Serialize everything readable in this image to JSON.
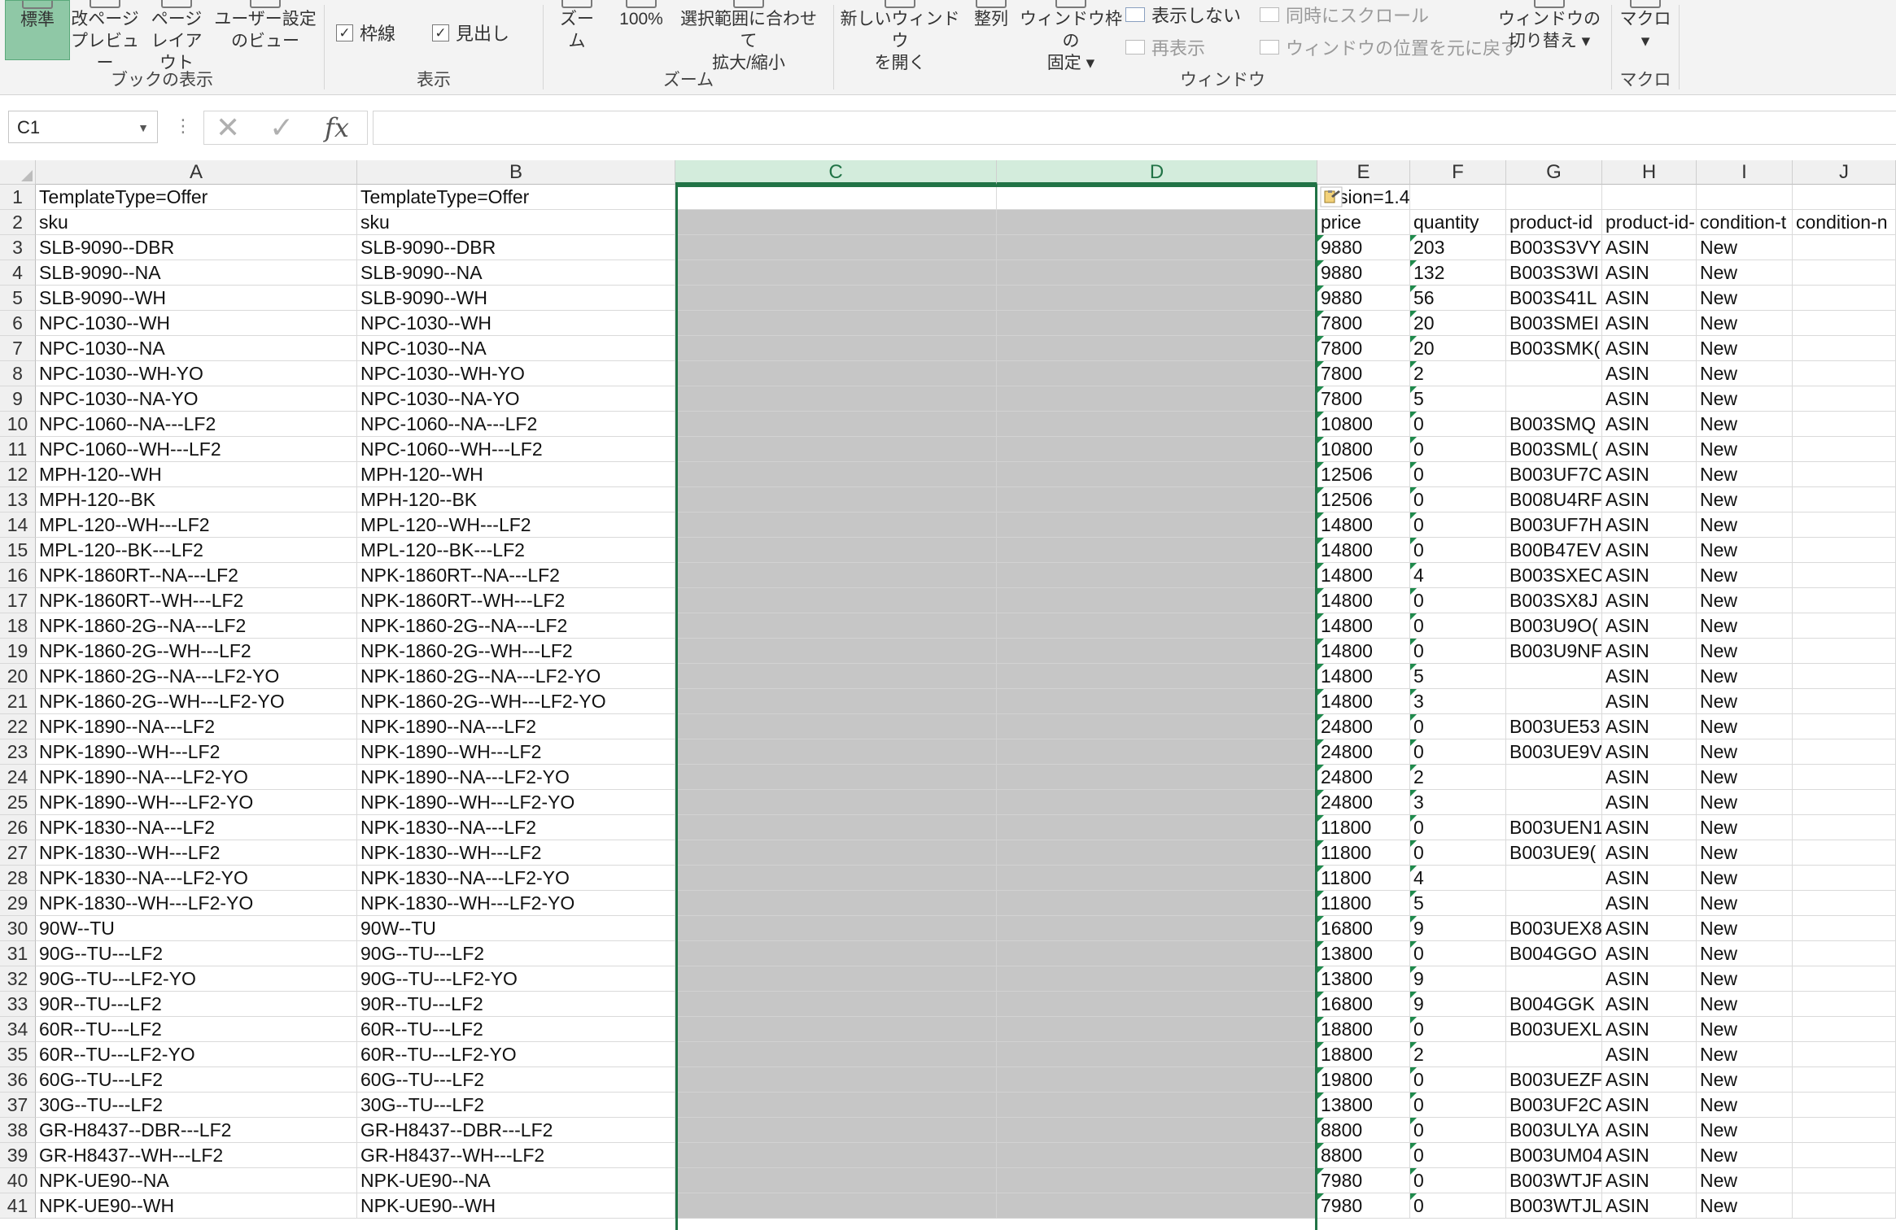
{
  "ribbon": {
    "groups": {
      "book_view": {
        "label": "ブックの表示",
        "buttons": [
          {
            "name": "normal",
            "label": "標準",
            "active": true
          },
          {
            "name": "page-break-preview",
            "label": "改ページ\nプレビュー"
          },
          {
            "name": "page-layout",
            "label": "ページ\nレイアウト"
          },
          {
            "name": "custom-views",
            "label": "ユーザー設定\nのビュー"
          }
        ]
      },
      "show": {
        "label": "表示",
        "gridlines": "枠線",
        "headings": "見出し"
      },
      "zoom": {
        "label": "ズーム",
        "buttons": [
          {
            "name": "zoom",
            "label": "ズーム"
          },
          {
            "name": "zoom-100",
            "label": "100%"
          },
          {
            "name": "zoom-to-selection",
            "label": "選択範囲に合わせて\n拡大/縮小"
          }
        ]
      },
      "window": {
        "label": "ウィンドウ",
        "new_window": "新しいウィンドウ\nを開く",
        "arrange": "整列",
        "freeze": "ウィンドウ枠の\n固定 ▾",
        "hide": "表示しない",
        "unhide": "再表示",
        "sync_scroll": "同時にスクロール",
        "reset_position": "ウィンドウの位置を元に戻す",
        "switch": "ウィンドウの\n切り替え ▾"
      },
      "macro": {
        "label": "マクロ",
        "macros": "マクロ\n▾"
      }
    }
  },
  "formula_bar": {
    "name_box": "C1",
    "formula": "",
    "fx_label": "fx"
  },
  "grid": {
    "columns": [
      "A",
      "B",
      "C",
      "D",
      "E",
      "F",
      "G",
      "H",
      "I",
      "J"
    ],
    "selected_columns": [
      "C",
      "D"
    ],
    "row1": {
      "A": "TemplateType=Offer",
      "B": "TemplateType=Offer",
      "E": "sion=1.4"
    },
    "row2": {
      "A": "sku",
      "B": "sku",
      "E": "price",
      "F": "quantity",
      "G": "product-id",
      "H": "product-id-",
      "I": "condition-t",
      "J": "condition-n"
    },
    "data_rows": [
      [
        "3",
        "SLB-9090--DBR",
        "SLB-9090--DBR",
        "9880",
        "203",
        "B003S3VY",
        "ASIN",
        "New"
      ],
      [
        "4",
        "SLB-9090--NA",
        "SLB-9090--NA",
        "9880",
        "132",
        "B003S3WI",
        "ASIN",
        "New"
      ],
      [
        "5",
        "SLB-9090--WH",
        "SLB-9090--WH",
        "9880",
        "56",
        "B003S41L",
        "ASIN",
        "New"
      ],
      [
        "6",
        "NPC-1030--WH",
        "NPC-1030--WH",
        "7800",
        "20",
        "B003SMEI",
        "ASIN",
        "New"
      ],
      [
        "7",
        "NPC-1030--NA",
        "NPC-1030--NA",
        "7800",
        "20",
        "B003SMK(",
        "ASIN",
        "New"
      ],
      [
        "8",
        "NPC-1030--WH-YO",
        "NPC-1030--WH-YO",
        "7800",
        "2",
        "",
        "ASIN",
        "New"
      ],
      [
        "9",
        "NPC-1030--NA-YO",
        "NPC-1030--NA-YO",
        "7800",
        "5",
        "",
        "ASIN",
        "New"
      ],
      [
        "10",
        "NPC-1060--NA---LF2",
        "NPC-1060--NA---LF2",
        "10800",
        "0",
        "B003SMQ",
        "ASIN",
        "New"
      ],
      [
        "11",
        "NPC-1060--WH---LF2",
        "NPC-1060--WH---LF2",
        "10800",
        "0",
        "B003SML(",
        "ASIN",
        "New"
      ],
      [
        "12",
        "MPH-120--WH",
        "MPH-120--WH",
        "12506",
        "0",
        "B003UF7C",
        "ASIN",
        "New"
      ],
      [
        "13",
        "MPH-120--BK",
        "MPH-120--BK",
        "12506",
        "0",
        "B008U4RF",
        "ASIN",
        "New"
      ],
      [
        "14",
        "MPL-120--WH---LF2",
        "MPL-120--WH---LF2",
        "14800",
        "0",
        "B003UF7H",
        "ASIN",
        "New"
      ],
      [
        "15",
        "MPL-120--BK---LF2",
        "MPL-120--BK---LF2",
        "14800",
        "0",
        "B00B47EV",
        "ASIN",
        "New"
      ],
      [
        "16",
        "NPK-1860RT--NA---LF2",
        "NPK-1860RT--NA---LF2",
        "14800",
        "4",
        "B003SXEC",
        "ASIN",
        "New"
      ],
      [
        "17",
        "NPK-1860RT--WH---LF2",
        "NPK-1860RT--WH---LF2",
        "14800",
        "0",
        "B003SX8J",
        "ASIN",
        "New"
      ],
      [
        "18",
        "NPK-1860-2G--NA---LF2",
        "NPK-1860-2G--NA---LF2",
        "14800",
        "0",
        "B003U9O(",
        "ASIN",
        "New"
      ],
      [
        "19",
        "NPK-1860-2G--WH---LF2",
        "NPK-1860-2G--WH---LF2",
        "14800",
        "0",
        "B003U9NF",
        "ASIN",
        "New"
      ],
      [
        "20",
        "NPK-1860-2G--NA---LF2-YO",
        "NPK-1860-2G--NA---LF2-YO",
        "14800",
        "5",
        "",
        "ASIN",
        "New"
      ],
      [
        "21",
        "NPK-1860-2G--WH---LF2-YO",
        "NPK-1860-2G--WH---LF2-YO",
        "14800",
        "3",
        "",
        "ASIN",
        "New"
      ],
      [
        "22",
        "NPK-1890--NA---LF2",
        "NPK-1890--NA---LF2",
        "24800",
        "0",
        "B003UE53",
        "ASIN",
        "New"
      ],
      [
        "23",
        "NPK-1890--WH---LF2",
        "NPK-1890--WH---LF2",
        "24800",
        "0",
        "B003UE9V",
        "ASIN",
        "New"
      ],
      [
        "24",
        "NPK-1890--NA---LF2-YO",
        "NPK-1890--NA---LF2-YO",
        "24800",
        "2",
        "",
        "ASIN",
        "New"
      ],
      [
        "25",
        "NPK-1890--WH---LF2-YO",
        "NPK-1890--WH---LF2-YO",
        "24800",
        "3",
        "",
        "ASIN",
        "New"
      ],
      [
        "26",
        "NPK-1830--NA---LF2",
        "NPK-1830--NA---LF2",
        "11800",
        "0",
        "B003UEN1",
        "ASIN",
        "New"
      ],
      [
        "27",
        "NPK-1830--WH---LF2",
        "NPK-1830--WH---LF2",
        "11800",
        "0",
        "B003UE9(",
        "ASIN",
        "New"
      ],
      [
        "28",
        "NPK-1830--NA---LF2-YO",
        "NPK-1830--NA---LF2-YO",
        "11800",
        "4",
        "",
        "ASIN",
        "New"
      ],
      [
        "29",
        "NPK-1830--WH---LF2-YO",
        "NPK-1830--WH---LF2-YO",
        "11800",
        "5",
        "",
        "ASIN",
        "New"
      ],
      [
        "30",
        "90W--TU",
        "90W--TU",
        "16800",
        "9",
        "B003UEX8",
        "ASIN",
        "New"
      ],
      [
        "31",
        "90G--TU---LF2",
        "90G--TU---LF2",
        "13800",
        "0",
        "B004GGO",
        "ASIN",
        "New"
      ],
      [
        "32",
        "90G--TU---LF2-YO",
        "90G--TU---LF2-YO",
        "13800",
        "9",
        "",
        "ASIN",
        "New"
      ],
      [
        "33",
        "90R--TU---LF2",
        "90R--TU---LF2",
        "16800",
        "9",
        "B004GGK",
        "ASIN",
        "New"
      ],
      [
        "34",
        "60R--TU---LF2",
        "60R--TU---LF2",
        "18800",
        "0",
        "B003UEXL",
        "ASIN",
        "New"
      ],
      [
        "35",
        "60R--TU---LF2-YO",
        "60R--TU---LF2-YO",
        "18800",
        "2",
        "",
        "ASIN",
        "New"
      ],
      [
        "36",
        "60G--TU---LF2",
        "60G--TU---LF2",
        "19800",
        "0",
        "B003UEZF",
        "ASIN",
        "New"
      ],
      [
        "37",
        "30G--TU---LF2",
        "30G--TU---LF2",
        "13800",
        "0",
        "B003UF2C",
        "ASIN",
        "New"
      ],
      [
        "38",
        "GR-H8437--DBR---LF2",
        "GR-H8437--DBR---LF2",
        "8800",
        "0",
        "B003ULYA",
        "ASIN",
        "New"
      ],
      [
        "39",
        "GR-H8437--WH---LF2",
        "GR-H8437--WH---LF2",
        "8800",
        "0",
        "B003UM04",
        "ASIN",
        "New"
      ],
      [
        "40",
        "NPK-UE90--NA",
        "NPK-UE90--NA",
        "7980",
        "0",
        "B003WTJF",
        "ASIN",
        "New"
      ],
      [
        "41",
        "NPK-UE90--WH",
        "NPK-UE90--WH",
        "7980",
        "0",
        "B003WTJL",
        "ASIN",
        "New"
      ]
    ]
  },
  "colors": {
    "excel_green": "#217346",
    "selected_shade": "#c6c6c6",
    "active_button": "#8fc8a6"
  }
}
